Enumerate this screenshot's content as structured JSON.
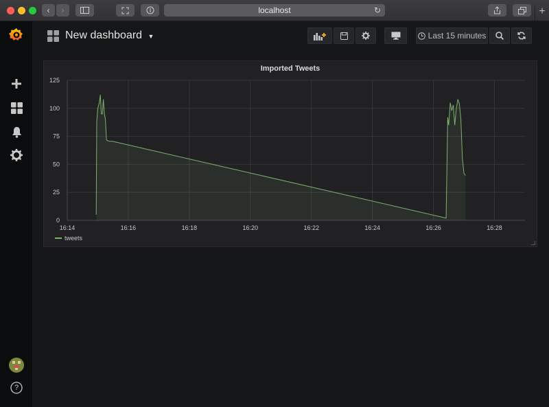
{
  "browser": {
    "url": "localhost",
    "colors": {
      "close": "#ff5f57",
      "minimize": "#febc2e",
      "zoom": "#28c840"
    }
  },
  "sidebar": {
    "logo": "grafana-logo-icon",
    "items": [
      "plus-icon",
      "dashboards-icon",
      "bell-icon",
      "gear-icon"
    ],
    "bottom": [
      "avatar",
      "help-icon"
    ],
    "help_label": "?"
  },
  "navbar": {
    "title": "New dashboard",
    "time_range": "Last 15 minutes",
    "buttons": [
      "add-panel-icon",
      "save-icon",
      "settings-icon",
      "tv-icon",
      "zoom-out-icon",
      "refresh-icon"
    ]
  },
  "panel": {
    "title": "Imported Tweets",
    "accent": "#7eb26d"
  },
  "chart_data": {
    "type": "area",
    "title": "Imported Tweets",
    "xlabel": "",
    "ylabel": "",
    "xlim": [
      "16:14",
      "16:29"
    ],
    "ylim": [
      0,
      125
    ],
    "x_ticks": [
      "16:14",
      "16:16",
      "16:18",
      "16:20",
      "16:22",
      "16:24",
      "16:26",
      "16:28"
    ],
    "y_ticks": [
      "0",
      "25",
      "50",
      "75",
      "100",
      "125"
    ],
    "grid": true,
    "legend": "bottom-left",
    "series": [
      {
        "name": "tweets",
        "color": "#7eb26d",
        "x": [
          "16:14:57",
          "16:14:58",
          "16:15:00",
          "16:15:03",
          "16:15:05",
          "16:15:07",
          "16:15:09",
          "16:15:11",
          "16:15:13",
          "16:15:15",
          "16:15:17",
          "16:15:19",
          "16:15:21",
          "16:15:23",
          "16:15:25",
          "16:15:27",
          "16:15:29",
          "16:26:25",
          "16:26:28",
          "16:26:30",
          "16:26:33",
          "16:26:36",
          "16:26:39",
          "16:26:42",
          "16:26:45",
          "16:26:48",
          "16:26:51",
          "16:26:54",
          "16:26:57",
          "16:27:00",
          "16:27:03"
        ],
        "y": [
          5,
          88,
          100,
          105,
          112,
          95,
          95,
          108,
          95,
          90,
          72,
          71,
          71,
          70.5,
          70.5,
          70.5,
          70.5,
          2,
          92,
          85,
          105,
          98,
          103,
          85,
          100,
          108,
          104,
          90,
          55,
          42,
          40
        ]
      }
    ]
  }
}
